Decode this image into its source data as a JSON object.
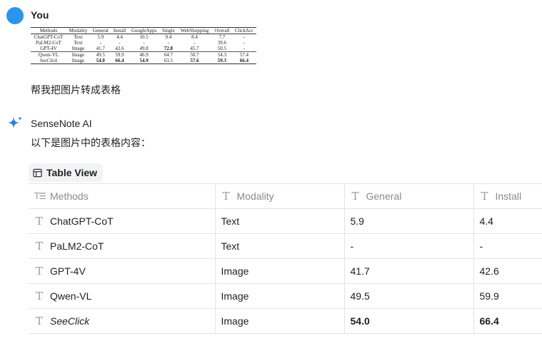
{
  "user": {
    "name": "You",
    "message": "帮我把图片转成表格",
    "image_table": {
      "headers": [
        "Methods",
        "Modality",
        "General",
        "Install",
        "GoogleApps",
        "Single",
        "WebShopping",
        "Overall",
        "ClickAcc"
      ],
      "rows": [
        [
          "ChatGPT-CoT",
          "Text",
          "5.9",
          "4.4",
          "10.5",
          "9.4",
          "8.4",
          "7.7",
          "-"
        ],
        [
          "PaLM2-CoT",
          "Text",
          "-",
          "-",
          "-",
          "-",
          "-",
          "39.6",
          "-"
        ],
        [
          "GPT-4V",
          "Image",
          "41.7",
          "42.6",
          "49.8",
          "72.8",
          "45.7",
          "50.5",
          "-"
        ],
        [
          "Qwen-VL",
          "Image",
          "49.5",
          "59.9",
          "46.9",
          "64.7",
          "50.7",
          "54.3",
          "57.4"
        ],
        [
          "SeeClick",
          "Image",
          "54.0",
          "66.4",
          "54.9",
          "63.5",
          "57.6",
          "59.3",
          "66.4"
        ]
      ]
    }
  },
  "assistant": {
    "name": "SenseNote AI",
    "message": "以下是图片中的表格内容：",
    "table_view_label": "Table View",
    "table": {
      "headers": [
        "Methods",
        "Modality",
        "General",
        "Install"
      ],
      "rows": [
        [
          "ChatGPT-CoT",
          "Text",
          "5.9",
          "4.4"
        ],
        [
          "PaLM2-CoT",
          "Text",
          "-",
          "-"
        ],
        [
          "GPT-4V",
          "Image",
          "41.7",
          "42.6"
        ],
        [
          "Qwen-VL",
          "Image",
          "49.5",
          "59.9"
        ],
        [
          "SeeClick",
          "Image",
          "54.0",
          "66.4"
        ]
      ]
    }
  },
  "colors": {
    "avatar": "#2b95ee",
    "ai_sparkle": "#2b7cf0",
    "header_text": "#8a8a8a",
    "border": "#e3e3e3"
  },
  "icons": {
    "title_column": "title-lines-icon",
    "text_column": "text-type-icon",
    "table_view": "table-icon",
    "assistant": "sparkle-icon"
  }
}
